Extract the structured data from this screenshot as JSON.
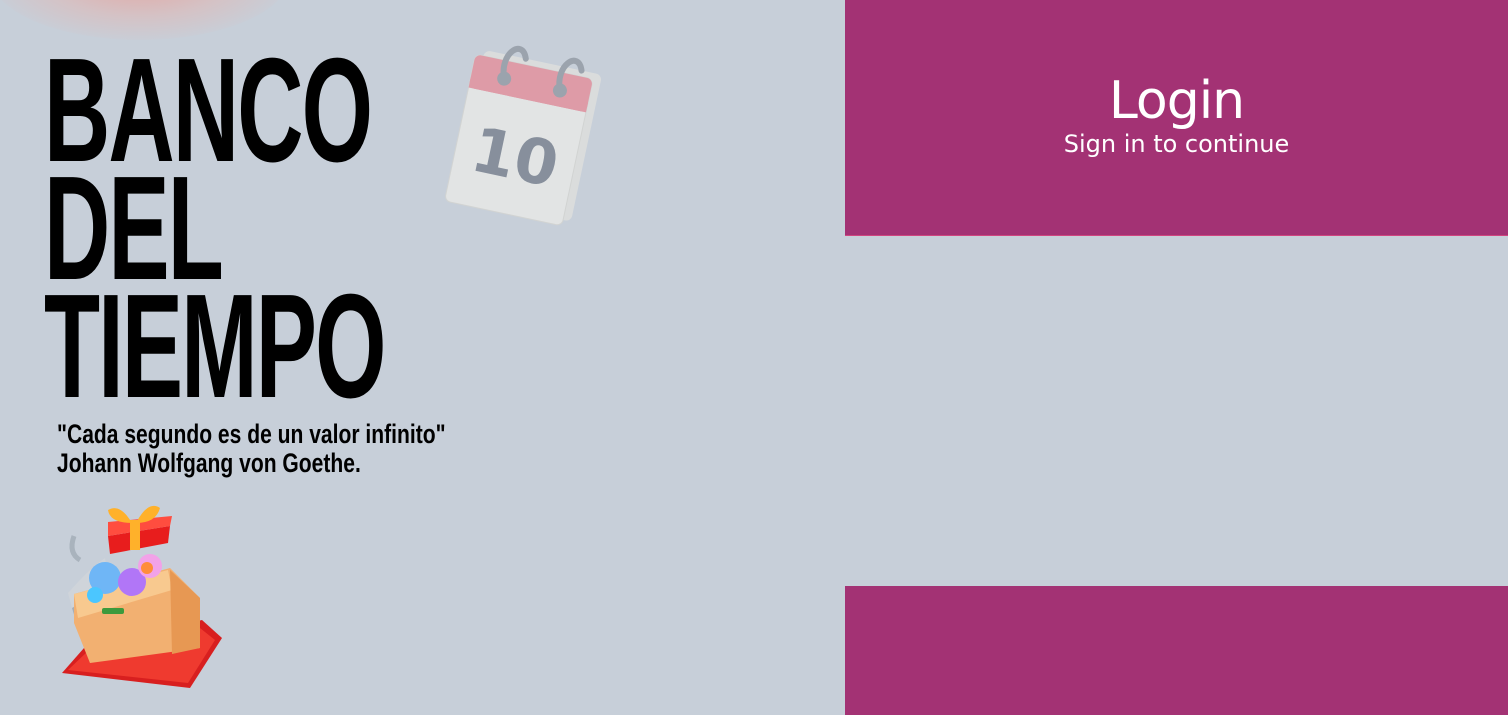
{
  "brand": {
    "title_line1": "BANCO",
    "title_line2": "DEL",
    "title_line3": "TIEMPO",
    "quote_line1": "\"Cada segundo es de un valor infinito\"",
    "quote_line2": "Johann Wolfgang von Goethe.",
    "calendar_icon": "calendar-icon",
    "calendar_day": "10",
    "gift_icon": "gift-box-icon"
  },
  "login": {
    "title": "Login",
    "subtitle": "Sign in to continue"
  },
  "colors": {
    "background": "#c7cfd9",
    "accent": "#a33274",
    "text_dark": "#000000",
    "text_light": "#ffffff"
  }
}
